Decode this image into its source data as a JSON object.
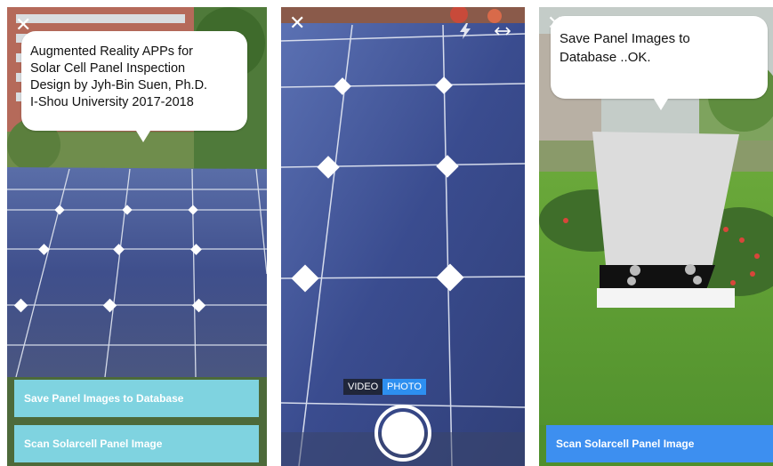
{
  "screens": [
    {
      "id": "ar-intro",
      "close_icon": "close-icon",
      "bubble": {
        "lines": [
          "Augmented Reality APPs for",
          "Solar Cell Panel Inspection",
          "Design by Jyh-Bin Suen, Ph.D.",
          "I-Shou University 2017-2018"
        ]
      },
      "buttons": {
        "save_label": "Save Panel Images to Database",
        "scan_label": "Scan Solarcell Panel Image"
      },
      "button_color": "#7fd3e0"
    },
    {
      "id": "camera",
      "close_icon": "close-icon",
      "flash_icon": "flash-icon",
      "flip_icon": "switch-camera-icon",
      "modes": {
        "video_label": "VIDEO",
        "photo_label": "PHOTO"
      },
      "active_mode_color": "#2d8ff0",
      "shutter_icon": "shutter-button"
    },
    {
      "id": "ar-save",
      "close_icon": "close-icon",
      "bubble": {
        "lines": [
          "Save Panel Images to",
          "Database ..OK."
        ]
      },
      "buttons": {
        "scan_label": "Scan Solarcell Panel Image"
      },
      "button_color": "#3d8ff0"
    }
  ]
}
